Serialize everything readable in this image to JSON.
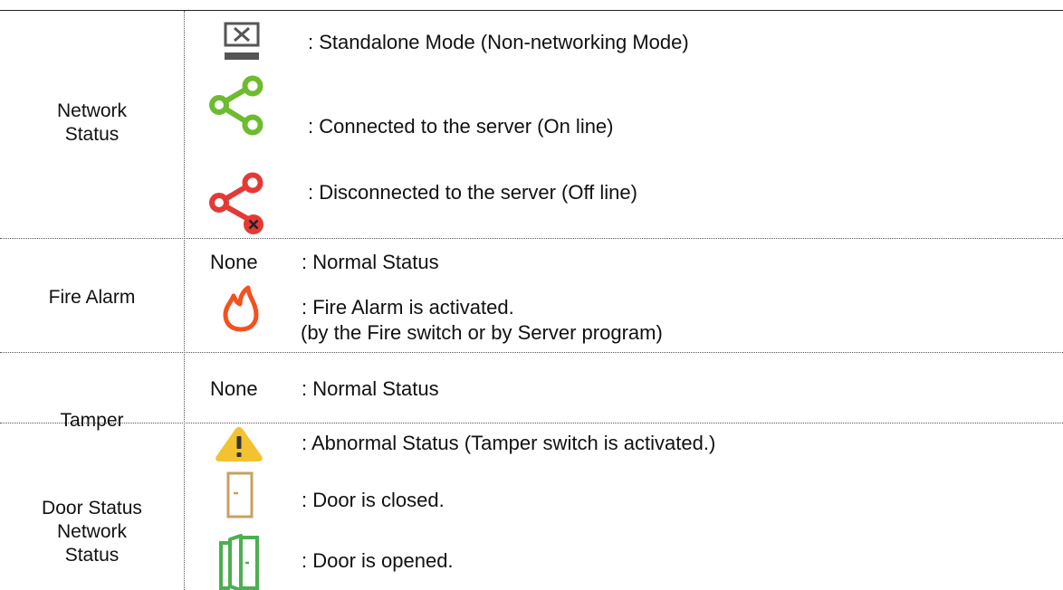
{
  "rows": [
    {
      "label": [
        "Network",
        "Status"
      ],
      "items": [
        {
          "icon": "standalone-monitor-icon",
          "text": ": Standalone Mode (Non-networking Mode)"
        },
        {
          "icon": "share-online-icon",
          "color": "#6dbb2e",
          "text": ": Connected to the server (On line)"
        },
        {
          "icon": "share-offline-icon",
          "color": "#e53935",
          "text": ": Disconnected to the server (Off line)"
        }
      ]
    },
    {
      "label": [
        "Fire Alarm"
      ],
      "none_label": "None",
      "items": [
        {
          "text": ": Normal Status"
        },
        {
          "icon": "fire-icon",
          "color": "#f4511e",
          "text": ": Fire Alarm is activated.",
          "text2": "(by the Fire switch or by Server program)"
        }
      ]
    },
    {
      "label": [
        "Tamper"
      ],
      "none_label": "None",
      "items": [
        {
          "text": ": Normal Status"
        },
        {
          "icon": "warning-icon",
          "color": "#f2c230",
          "text": ": Abnormal Status (Tamper switch is activated.)"
        }
      ]
    },
    {
      "label": [
        "Door Status",
        "Network",
        "Status"
      ],
      "items": [
        {
          "icon": "door-closed-icon",
          "color": "#c8a063",
          "text": ": Door is closed."
        },
        {
          "icon": "door-opened-icon",
          "color": "#4caf50",
          "text": ": Door is opened."
        }
      ]
    }
  ]
}
